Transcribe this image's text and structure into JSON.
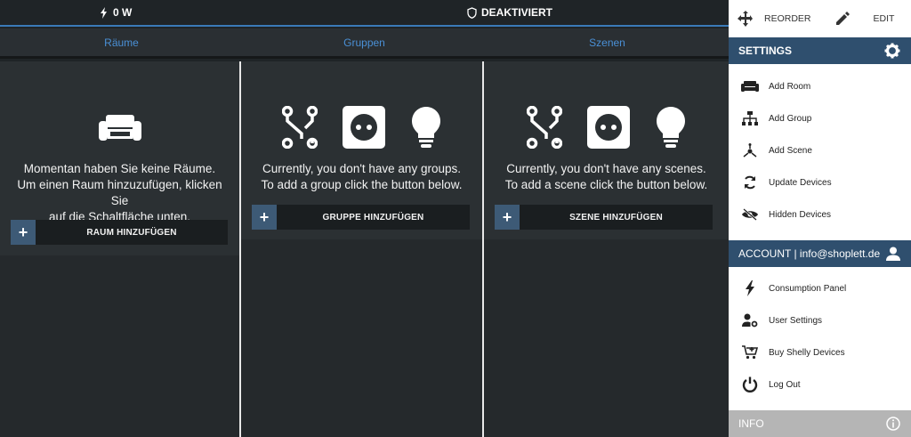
{
  "topbar": {
    "power": "0 W",
    "alarm": "DEAKTIVIERT"
  },
  "tabs": [
    "Räume",
    "Gruppen",
    "Szenen"
  ],
  "rooms": {
    "message": [
      "Momentan haben Sie keine Räume.",
      "Um einen Raum hinzuzufügen, klicken Sie",
      "auf die Schaltfläche unten."
    ],
    "button": "RAUM HINZUFÜGEN",
    "icon": "sofa-icon"
  },
  "groups": {
    "message": [
      "Currently, you don't have any groups.",
      "To add a group click the button below."
    ],
    "button": "GRUPPE HINZUFÜGEN",
    "icons": [
      "relay-icon",
      "socket-icon",
      "bulb-icon"
    ]
  },
  "scenes": {
    "message": [
      "Currently, you don't have any scenes.",
      "To add a scene click the button below."
    ],
    "button": "SZENE HINZUFÜGEN",
    "icons": [
      "relay-icon",
      "socket-icon",
      "bulb-icon"
    ]
  },
  "panel": {
    "reorder": "REORDER",
    "edit": "EDIT",
    "settings_title": "SETTINGS",
    "settings_items": [
      "Add Room",
      "Add Group",
      "Add Scene",
      "Update Devices",
      "Hidden Devices"
    ],
    "account_title": "ACCOUNT | info@shoplett.de",
    "account_items": [
      "Consumption Panel",
      "User Settings",
      "Buy Shelly Devices",
      "Log Out"
    ],
    "info_title": "INFO"
  },
  "colors": {
    "accent": "#4a90d6",
    "panel_header": "#2f4f6e",
    "background": "#2b3033"
  }
}
